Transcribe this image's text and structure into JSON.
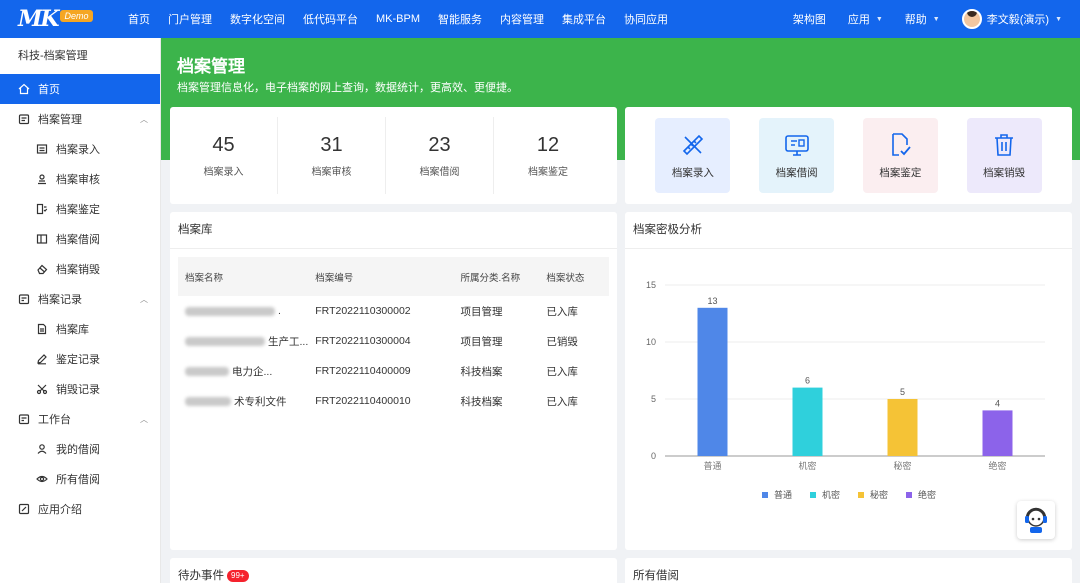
{
  "topbar": {
    "logo_text": "MK",
    "logo_badge": "Demo",
    "nav": [
      "首页",
      "门户管理",
      "数字化空间",
      "低代码平台",
      "MK-BPM",
      "智能服务",
      "内容管理",
      "集成平台",
      "协同应用"
    ],
    "right": {
      "arch": "架构图",
      "apps": "应用",
      "help": "帮助",
      "user": "李文毅(演示)"
    }
  },
  "sidebar": {
    "title": "科技-档案管理",
    "items": [
      {
        "label": "首页",
        "icon": "home-icon",
        "level": 0,
        "active": true
      },
      {
        "label": "档案管理",
        "icon": "folder-icon",
        "level": 0,
        "group": true
      },
      {
        "label": "档案录入",
        "icon": "entry-icon",
        "level": 1
      },
      {
        "label": "档案审核",
        "icon": "audit-icon",
        "level": 1
      },
      {
        "label": "档案鉴定",
        "icon": "appraise-icon",
        "level": 1
      },
      {
        "label": "档案借阅",
        "icon": "borrow-icon",
        "level": 1
      },
      {
        "label": "档案销毁",
        "icon": "destroy-icon",
        "level": 1
      },
      {
        "label": "档案记录",
        "icon": "record-icon",
        "level": 0,
        "group": true
      },
      {
        "label": "档案库",
        "icon": "library-icon",
        "level": 1
      },
      {
        "label": "鉴定记录",
        "icon": "pen-icon",
        "level": 1
      },
      {
        "label": "销毁记录",
        "icon": "scissors-icon",
        "level": 1
      },
      {
        "label": "工作台",
        "icon": "desk-icon",
        "level": 0,
        "group": true
      },
      {
        "label": "我的借阅",
        "icon": "user-icon",
        "level": 1
      },
      {
        "label": "所有借阅",
        "icon": "eye-icon",
        "level": 1
      },
      {
        "label": "应用介绍",
        "icon": "intro-icon",
        "level": 0
      }
    ]
  },
  "banner": {
    "title": "档案管理",
    "subtitle": "档案管理信息化，电子档案的网上查询，数据统计，更高效、更便捷。"
  },
  "stats": [
    {
      "value": "45",
      "label": "档案录入"
    },
    {
      "value": "31",
      "label": "档案审核"
    },
    {
      "value": "23",
      "label": "档案借阅"
    },
    {
      "value": "12",
      "label": "档案鉴定"
    }
  ],
  "quick_actions": [
    {
      "label": "档案录入",
      "icon": "ruler-pencil-icon",
      "bg": "#e6eeff",
      "color": "#1366ec"
    },
    {
      "label": "档案借阅",
      "icon": "monitor-icon",
      "bg": "#e4f3fb",
      "color": "#1366ec"
    },
    {
      "label": "档案鉴定",
      "icon": "doc-check-icon",
      "bg": "#fbeef0",
      "color": "#1366ec"
    },
    {
      "label": "档案销毁",
      "icon": "trash-icon",
      "bg": "#ede9fb",
      "color": "#1366ec"
    }
  ],
  "library": {
    "title": "档案库",
    "columns": [
      "档案名称",
      "档案编号",
      "所属分类.名称",
      "档案状态"
    ],
    "rows": [
      {
        "name": ".",
        "code": "FRT2022110300002",
        "category": "项目管理",
        "status": "已入库"
      },
      {
        "name": "生产工...",
        "code": "FRT2022110300004",
        "category": "项目管理",
        "status": "已销毁"
      },
      {
        "name": "电力企...",
        "code": "FRT2022110400009",
        "category": "科技档案",
        "status": "已入库"
      },
      {
        "name": "术专利文件",
        "code": "FRT2022110400010",
        "category": "科技档案",
        "status": "已入库"
      }
    ]
  },
  "chart_card": {
    "title": "档案密极分析"
  },
  "chart_data": {
    "type": "bar",
    "categories": [
      "普通",
      "机密",
      "秘密",
      "绝密"
    ],
    "values": [
      13,
      6,
      5,
      4
    ],
    "colors": [
      "#4f87e8",
      "#2fd0dc",
      "#f5c336",
      "#8c63ea"
    ],
    "yticks": [
      0,
      5,
      10,
      15
    ],
    "ylim": [
      0,
      15
    ],
    "legend": [
      "普通",
      "机密",
      "秘密",
      "绝密"
    ],
    "legend_position": "bottom"
  },
  "bottom": {
    "todo_title": "待办事件",
    "todo_badge": "99+",
    "all_borrow_title": "所有借阅"
  }
}
